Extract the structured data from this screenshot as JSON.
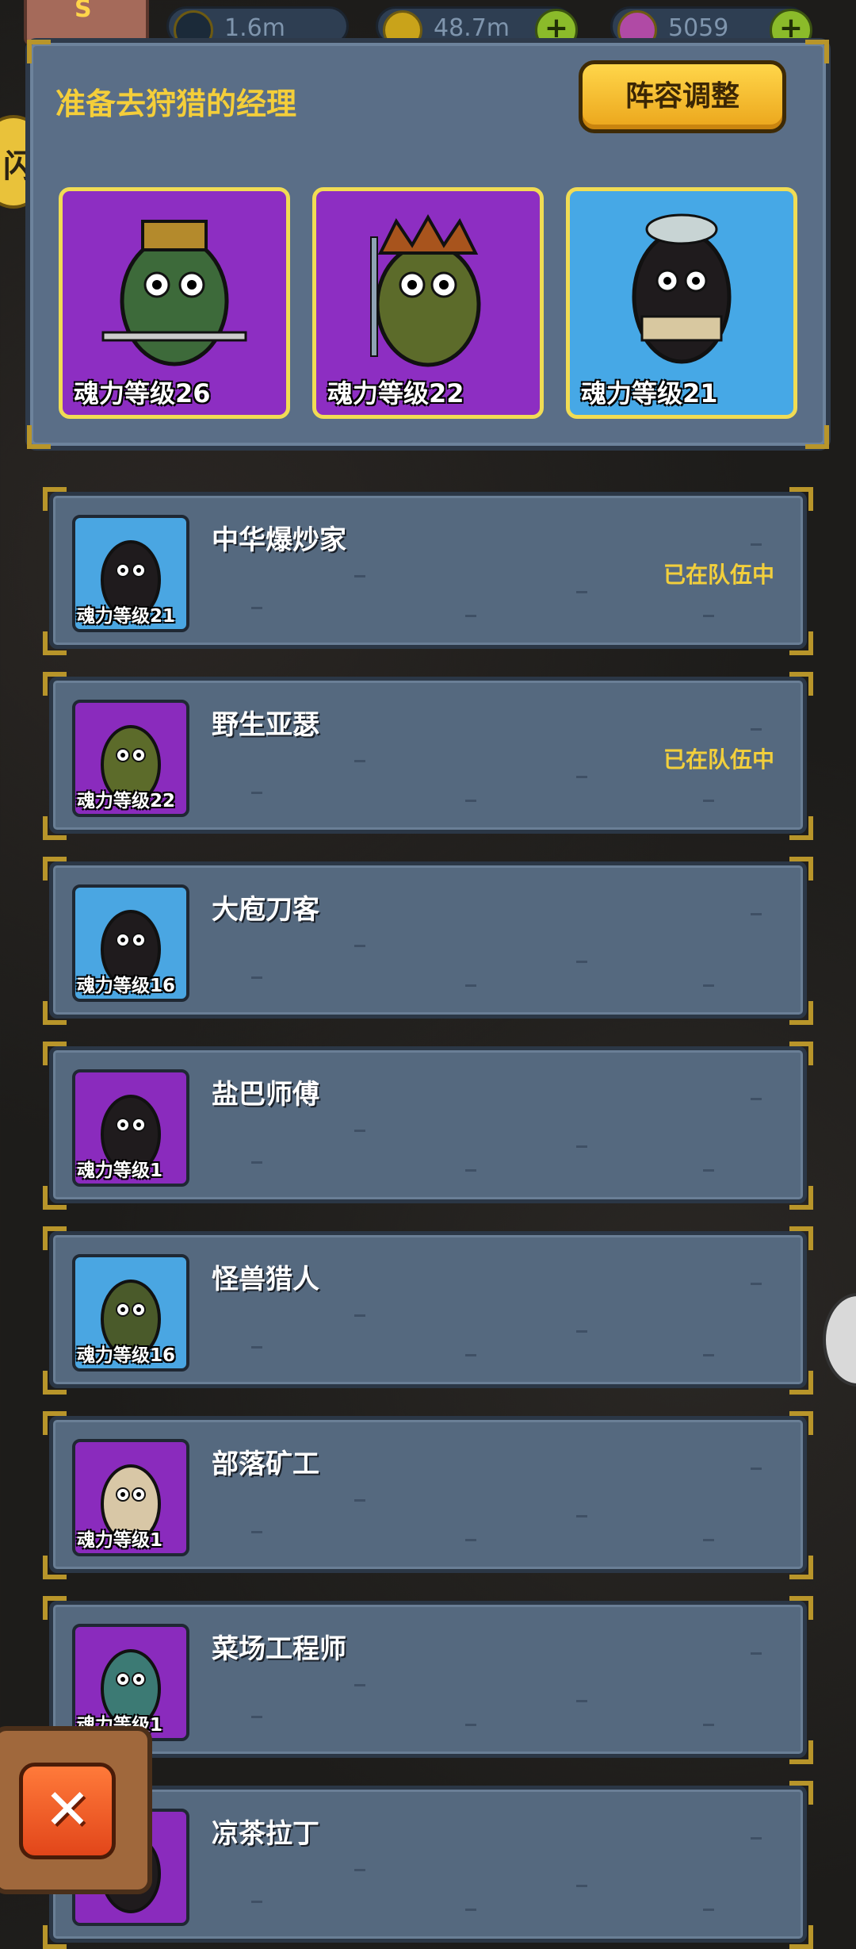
{
  "resources": [
    {
      "icon": "eye-icon",
      "value": "1.6m"
    },
    {
      "icon": "coin-icon",
      "value": "48.7m"
    },
    {
      "icon": "potion-icon",
      "value": "5059"
    }
  ],
  "header": {
    "title": "准备去狩猎的经理",
    "lineup_button": "阵容调整",
    "avatar_letter": "S",
    "left_badge_glyph": "闪"
  },
  "team": [
    {
      "level_label": "魂力等级26",
      "rarity": "purple"
    },
    {
      "level_label": "魂力等级22",
      "rarity": "purple"
    },
    {
      "level_label": "魂力等级21",
      "rarity": "blue"
    }
  ],
  "managers": [
    {
      "name": "中华爆炒家",
      "level_label": "魂力等级21",
      "rarity": "blue",
      "status": "已在队伍中"
    },
    {
      "name": "野生亚瑟",
      "level_label": "魂力等级22",
      "rarity": "purple",
      "status": "已在队伍中"
    },
    {
      "name": "大庖刀客",
      "level_label": "魂力等级16",
      "rarity": "blue",
      "status": ""
    },
    {
      "name": "盐巴师傅",
      "level_label": "魂力等级1",
      "rarity": "purple",
      "status": ""
    },
    {
      "name": "怪兽猎人",
      "level_label": "魂力等级16",
      "rarity": "blue",
      "status": ""
    },
    {
      "name": "部落矿工",
      "level_label": "魂力等级1",
      "rarity": "purple",
      "status": ""
    },
    {
      "name": "菜场工程师",
      "level_label": "魂力等级1",
      "rarity": "purple",
      "status": ""
    },
    {
      "name": "凉茶拉丁",
      "level_label": "",
      "rarity": "purple",
      "status": ""
    }
  ],
  "close_button": "✕"
}
